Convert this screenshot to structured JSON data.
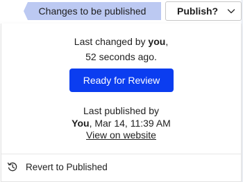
{
  "topbar": {
    "status_label": "Changes to be published",
    "publish_label": "Publish?"
  },
  "panel": {
    "last_changed_prefix": "Last changed by ",
    "last_changed_user": "you",
    "last_changed_suffix": ",",
    "last_changed_time": "52 seconds ago.",
    "review_button_label": "Ready for Review",
    "last_published_label": "Last published by",
    "last_published_user": "You",
    "last_published_time": ", Mar 14, 11:39 AM",
    "view_link_label": "View on website",
    "revert_label": "Revert to Published"
  },
  "colors": {
    "status_pill": "#bcc9f2",
    "primary_button": "#0b3df0"
  },
  "icons": {
    "publish_dropdown": "chevron-down-icon",
    "revert": "history-icon"
  }
}
